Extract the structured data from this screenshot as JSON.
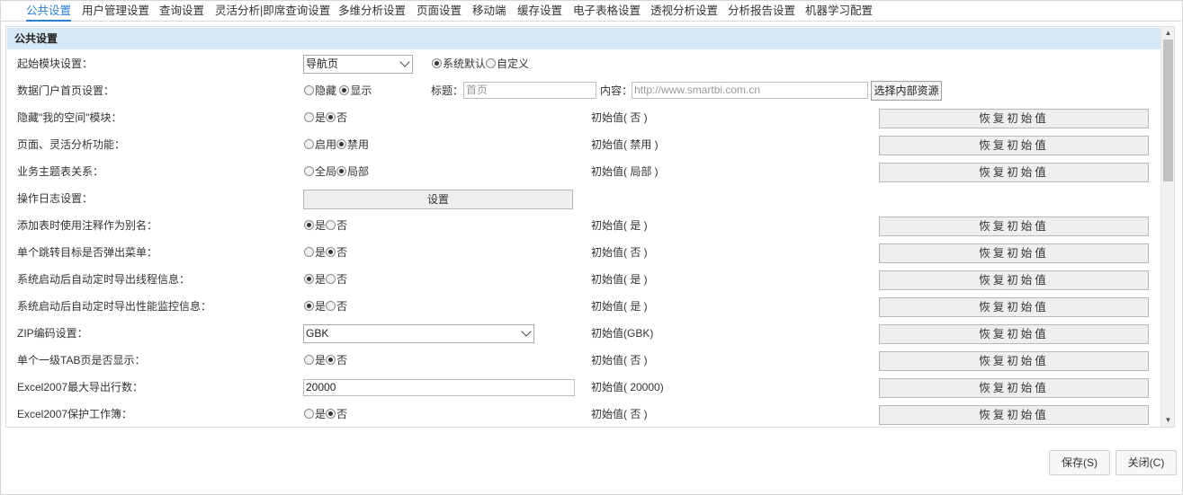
{
  "tabs": [
    {
      "label": "公共设置",
      "active": true
    },
    {
      "label": "用户管理设置"
    },
    {
      "label": "查询设置"
    },
    {
      "label": "灵活分析|即席查询设置"
    },
    {
      "label": "多维分析设置"
    },
    {
      "label": "页面设置"
    },
    {
      "label": "移动端"
    },
    {
      "label": "缓存设置"
    },
    {
      "label": "电子表格设置"
    },
    {
      "label": "透视分析设置"
    },
    {
      "label": "分析报告设置"
    },
    {
      "label": "机器学习配置"
    }
  ],
  "panel": {
    "title": "公共设置"
  },
  "restore_label": "恢复初始值",
  "rows": {
    "start_module": {
      "label": "起始模块设置：",
      "select_value": "导航页",
      "options": [
        {
          "label": "系统默认",
          "checked": true
        },
        {
          "label": "自定义",
          "checked": false
        }
      ]
    },
    "portal_home": {
      "label": "数据门户首页设置：",
      "options": [
        {
          "label": "隐藏",
          "checked": false
        },
        {
          "label": "显示",
          "checked": true
        }
      ],
      "title_label": "标题：",
      "title_placeholder": "首页",
      "content_label": "内容：",
      "content_placeholder": "http://www.smartbi.com.cn",
      "select_resource": "选择内部资源"
    },
    "hide_my_space": {
      "label": "隐藏\"我的空间\"模块：",
      "options": [
        {
          "label": "是",
          "checked": false
        },
        {
          "label": "否",
          "checked": true
        }
      ],
      "initial": "初始值( 否 )"
    },
    "page_flex": {
      "label": "页面、灵活分析功能：",
      "options": [
        {
          "label": "启用",
          "checked": false
        },
        {
          "label": "禁用",
          "checked": true
        }
      ],
      "initial": "初始值( 禁用 )"
    },
    "topic_relation": {
      "label": "业务主题表关系：",
      "options": [
        {
          "label": "全局",
          "checked": false
        },
        {
          "label": "局部",
          "checked": true
        }
      ],
      "initial": "初始值( 局部 )"
    },
    "op_log": {
      "label": "操作日志设置：",
      "button": "设置"
    },
    "comment_alias": {
      "label": "添加表时使用注释作为别名：",
      "options": [
        {
          "label": "是",
          "checked": true
        },
        {
          "label": "否",
          "checked": false
        }
      ],
      "initial": "初始值( 是 )"
    },
    "jump_menu": {
      "label": "单个跳转目标是否弹出菜单：",
      "options": [
        {
          "label": "是",
          "checked": false
        },
        {
          "label": "否",
          "checked": true
        }
      ],
      "initial": "初始值( 否 )"
    },
    "thread_info": {
      "label": "系统启动后自动定时导出线程信息：",
      "options": [
        {
          "label": "是",
          "checked": true
        },
        {
          "label": "否",
          "checked": false
        }
      ],
      "initial": "初始值( 是 )"
    },
    "perf_monitor": {
      "label": "系统启动后自动定时导出性能监控信息：",
      "options": [
        {
          "label": "是",
          "checked": true
        },
        {
          "label": "否",
          "checked": false
        }
      ],
      "initial": "初始值( 是 )"
    },
    "zip_encoding": {
      "label": "ZIP编码设置：",
      "select_value": "GBK",
      "initial": "初始值(GBK)"
    },
    "single_tab": {
      "label": "单个一级TAB页是否显示：",
      "options": [
        {
          "label": "是",
          "checked": false
        },
        {
          "label": "否",
          "checked": true
        }
      ],
      "initial": "初始值( 否 )"
    },
    "excel_max_rows": {
      "label": "Excel2007最大导出行数：",
      "value": "20000",
      "initial": "初始值( 20000)"
    },
    "excel_protect": {
      "label": "Excel2007保护工作簿：",
      "options": [
        {
          "label": "是",
          "checked": false
        },
        {
          "label": "否",
          "checked": true
        }
      ],
      "initial": "初始值( 否 )"
    }
  },
  "footer": {
    "save": "保存(S)",
    "close": "关闭(C)"
  }
}
